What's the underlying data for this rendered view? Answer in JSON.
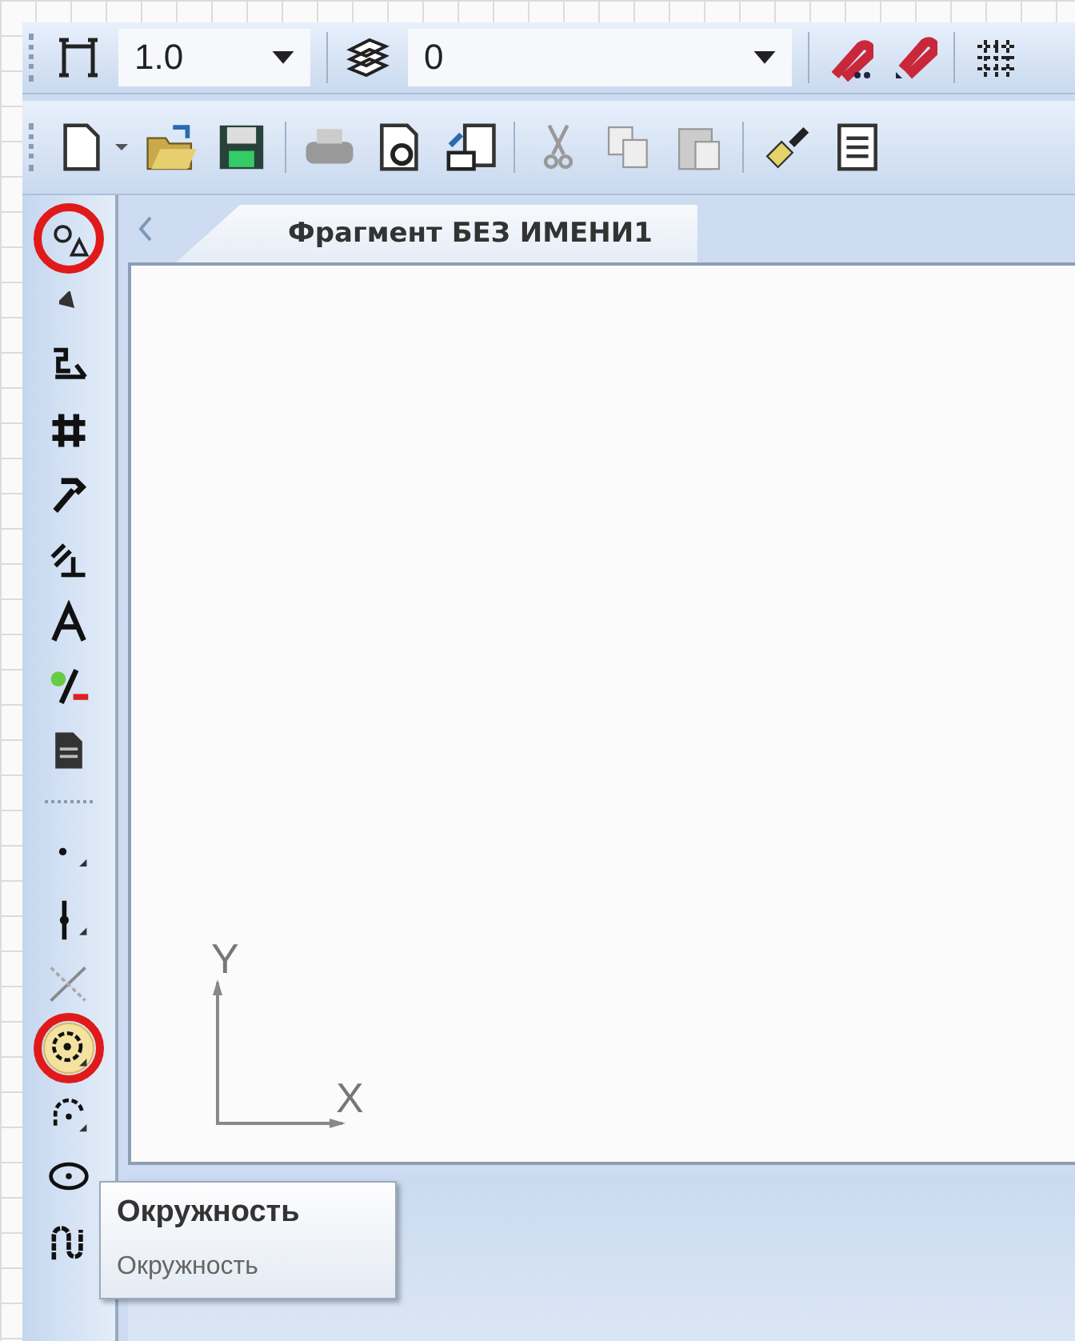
{
  "toolbar_top": {
    "line_scale": {
      "value": "1.0"
    },
    "layer": {
      "value": "0"
    }
  },
  "tabs": [
    {
      "label": "Фрагмент БЕЗ ИМЕНИ1",
      "selected": true
    }
  ],
  "tools": [
    {
      "kind": "geometry",
      "highlighted": true,
      "hovered": false
    },
    {
      "kind": "expand",
      "highlighted": false,
      "hovered": false
    },
    {
      "kind": "dimensions",
      "highlighted": false,
      "hovered": false
    },
    {
      "kind": "edit",
      "highlighted": false,
      "hovered": false
    },
    {
      "kind": "parametrize",
      "highlighted": false,
      "hovered": false
    },
    {
      "kind": "designations",
      "highlighted": false,
      "hovered": false
    },
    {
      "kind": "measure",
      "highlighted": false,
      "hovered": false
    },
    {
      "kind": "select",
      "highlighted": false,
      "hovered": false
    },
    {
      "kind": "spec",
      "highlighted": false,
      "hovered": false
    }
  ],
  "shape_tools": [
    {
      "kind": "point",
      "highlighted": false,
      "hovered": false
    },
    {
      "kind": "aux-line",
      "highlighted": false,
      "hovered": false
    },
    {
      "kind": "segment",
      "highlighted": false,
      "hovered": false
    },
    {
      "kind": "circle",
      "highlighted": true,
      "hovered": true
    },
    {
      "kind": "arc",
      "highlighted": false,
      "hovered": false
    },
    {
      "kind": "ellipse",
      "highlighted": false,
      "hovered": false
    },
    {
      "kind": "curve",
      "highlighted": false,
      "hovered": false
    }
  ],
  "canvas": {
    "axis_y": "Y",
    "axis_x": "X"
  },
  "tooltip": {
    "title": "Окружность",
    "description": "Окружность"
  }
}
